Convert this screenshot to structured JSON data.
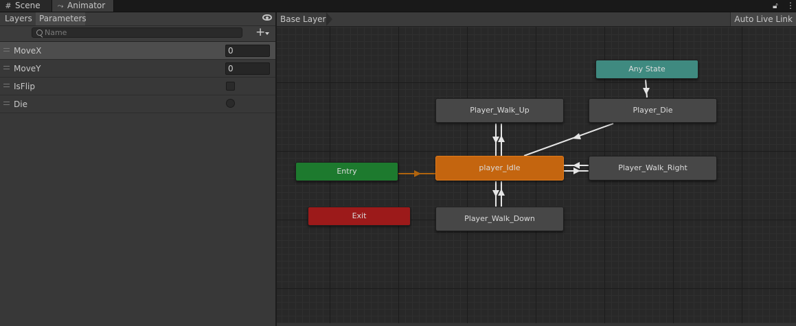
{
  "tabs": {
    "scene": "Scene",
    "animator": "Animator"
  },
  "window_controls": {
    "lock_icon": "lock-icon",
    "menu_icon": "kebab-menu-icon"
  },
  "left_panel": {
    "tabs": {
      "layers": "Layers",
      "parameters": "Parameters"
    },
    "search": {
      "placeholder": "Name",
      "value": ""
    },
    "parameters": [
      {
        "name": "MoveX",
        "type": "float",
        "value": "0",
        "selected": true
      },
      {
        "name": "MoveY",
        "type": "float",
        "value": "0",
        "selected": false
      },
      {
        "name": "IsFlip",
        "type": "bool",
        "checked": false
      },
      {
        "name": "Die",
        "type": "trigger",
        "set": false
      }
    ]
  },
  "graph": {
    "breadcrumb": "Base Layer",
    "auto_live_link": "Auto Live Link",
    "nodes": {
      "any_state": "Any State",
      "player_die": "Player_Die",
      "walk_up": "Player_Walk_Up",
      "idle": "player_Idle",
      "walk_right": "Player_Walk_Right",
      "entry": "Entry",
      "exit": "Exit",
      "walk_down": "Player_Walk_Down"
    }
  },
  "colors": {
    "entry": "#1d7a2e",
    "exit": "#9c1a1a",
    "any_state": "#3f8a80",
    "default_state": "#c4650f",
    "state": "#474747",
    "transition": "#e0e0e0",
    "default_transition": "#b0640e"
  }
}
